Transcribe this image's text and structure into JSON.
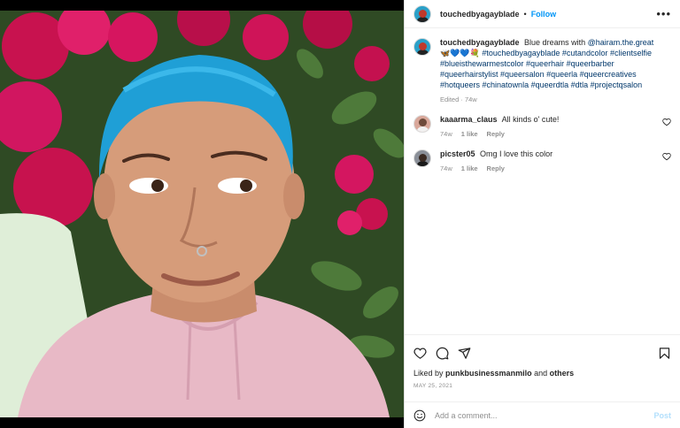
{
  "post": {
    "username": "touchedbyagayblade",
    "follow_label": "Follow",
    "dot": "•",
    "more_label": "•••"
  },
  "caption": {
    "username": "touchedbyagayblade",
    "text": "Blue dreams with",
    "mention": "@hairam.the.great",
    "emoji": "🦋💙💙💐",
    "hashtags": "#touchedbyagayblade #cutandcolor #clientselfie #blueisthewarmestcolor #queerhair #queerbarber #queerhairstylist #queersalon #queerla #queercreatives #hotqueers #chinatownla #queerdtla #dtla #projectqsalon",
    "edited": "Edited",
    "age": "74w"
  },
  "comments": [
    {
      "username": "kaaarma_claus",
      "text": "All kinds o' cute!",
      "age": "74w",
      "likes": "1 like",
      "reply": "Reply"
    },
    {
      "username": "picster05",
      "text": "Omg I love this color",
      "age": "74w",
      "likes": "1 like",
      "reply": "Reply"
    }
  ],
  "footer": {
    "liked_prefix": "Liked by",
    "liked_user": "punkbusinessmanmilo",
    "liked_and": "and",
    "liked_others": "others",
    "date": "MAY 25, 2021",
    "comment_placeholder": "Add a comment...",
    "post_label": "Post"
  },
  "colors": {
    "accent": "#0095f6",
    "post_disabled": "#b2dffc",
    "hair": "#1f9fd6",
    "flowers": "#d6155f"
  }
}
